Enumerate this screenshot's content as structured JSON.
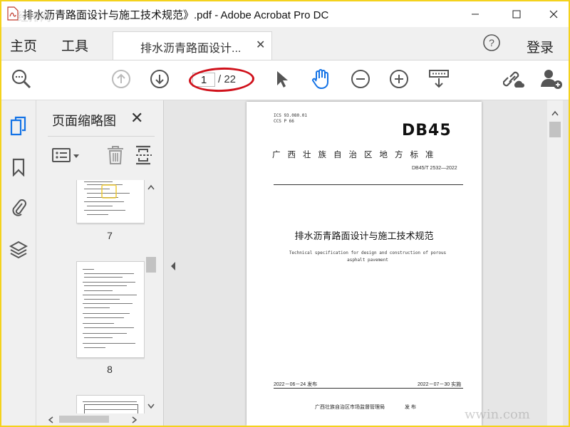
{
  "window": {
    "title": "排水沥青路面设计与施工技术规范》.pdf - Adobe Acrobat Pro DC",
    "faint_overlay": "经排网"
  },
  "menubar": {
    "home": "主页",
    "tools": "工具",
    "tab_label": "排水沥青路面设计...",
    "login": "登录"
  },
  "toolbar": {
    "current_page": "1",
    "total_pages": "/ 22"
  },
  "sidebar": {
    "title": "页面缩略图",
    "thumbnails": [
      {
        "label": "7"
      },
      {
        "label": "8"
      }
    ]
  },
  "document": {
    "ics": "ICS  93.080.01",
    "ccs": "CCS  P 66",
    "code": "DB45",
    "std_label": "广西壮族自治区地方标准",
    "std_no": "DB45/T 2532—2022",
    "title_cn": "排水沥青路面设计与施工技术规范",
    "title_en_1": "Technical specification for design and construction of porous",
    "title_en_2": "asphalt pavement",
    "release_date": "2022－06－24 发布",
    "impl_date": "2022－07－30 实施",
    "publisher": "广西壮族自治区市场监督管理局",
    "publish_word": "发 布"
  },
  "watermark_bottom": "wwin.com",
  "colors": {
    "frame": "#f4d21c",
    "highlight_ellipse": "#d0111b",
    "active_blue": "#1473e6"
  }
}
